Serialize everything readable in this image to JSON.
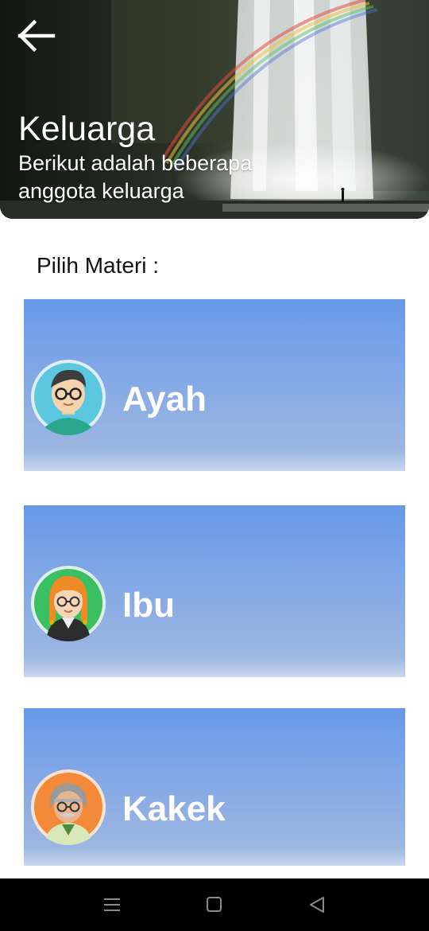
{
  "header": {
    "title": "Keluarga",
    "subtitle": "Berikut adalah beberapa anggota keluarga",
    "back_icon": "arrow-left-icon"
  },
  "section_label": "Pilih Materi :",
  "items": [
    {
      "label": "Ayah",
      "avatar": "father-avatar-icon",
      "avatar_bg": "#5bc8e0"
    },
    {
      "label": "Ibu",
      "avatar": "mother-avatar-icon",
      "avatar_bg": "#3bbf63"
    },
    {
      "label": "Kakek",
      "avatar": "grandfather-avatar-icon",
      "avatar_bg": "#f5893a"
    }
  ],
  "navbar": {
    "menu_icon": "menu-icon",
    "home_icon": "home-square-icon",
    "back_icon": "back-triangle-icon"
  },
  "colors": {
    "card_top": "#6699e8",
    "card_bottom": "#c9d7ef",
    "text_on_card": "#ffffff"
  }
}
